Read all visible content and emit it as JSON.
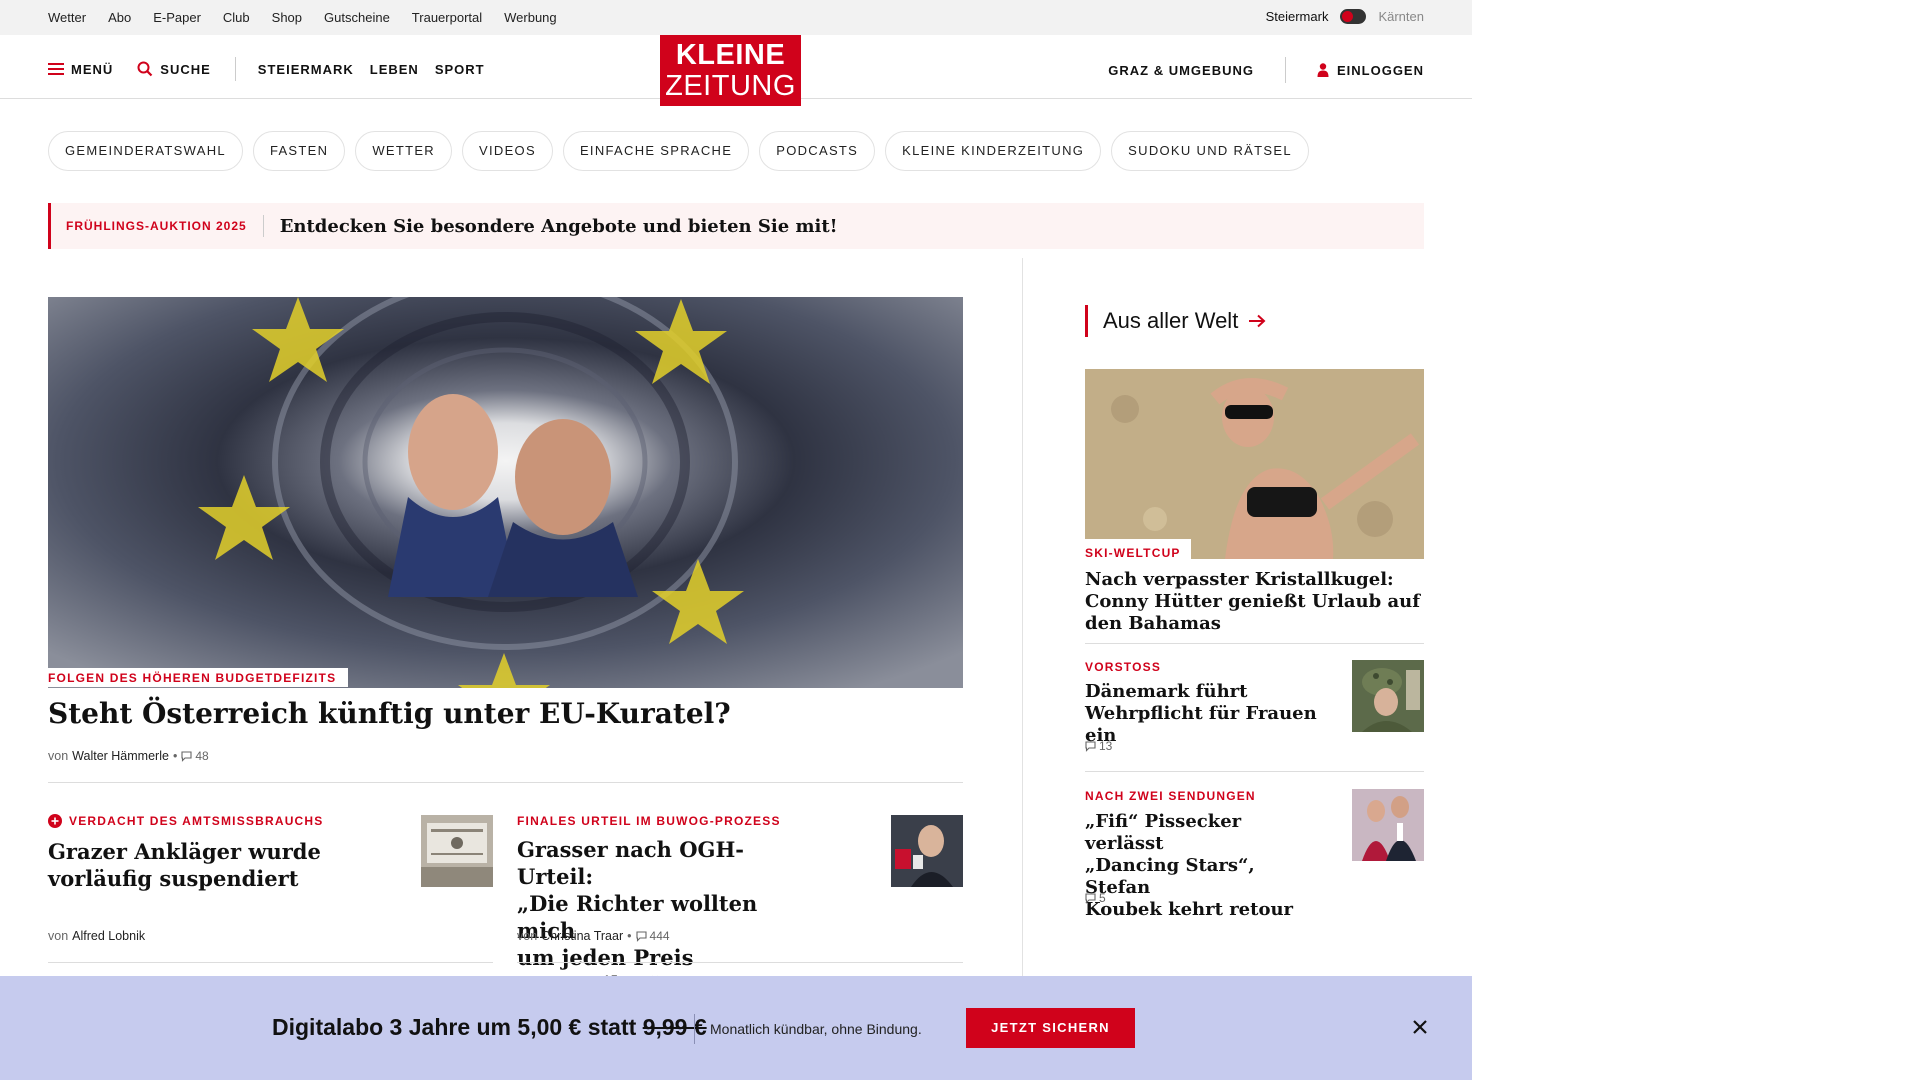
{
  "topbar": {
    "links": [
      "Wetter",
      "Abo",
      "E-Paper",
      "Club",
      "Shop",
      "Gutscheine",
      "Trauerportal",
      "Werbung"
    ],
    "region_active": "Steiermark",
    "region_inactive": "Kärnten"
  },
  "header": {
    "menu_label": "MENÜ",
    "search_label": "SUCHE",
    "nav": [
      "STEIERMARK",
      "LEBEN",
      "SPORT"
    ],
    "logo_line1": "KLEINE",
    "logo_line2": "ZEITUNG",
    "region_link": "GRAZ & UMGEBUNG",
    "login_label": "EINLOGGEN"
  },
  "tags": [
    "GEMEINDERATSWAHL",
    "FASTEN",
    "WETTER",
    "VIDEOS",
    "EINFACHE SPRACHE",
    "PODCASTS",
    "KLEINE KINDERZEITUNG",
    "SUDOKU UND RÄTSEL"
  ],
  "promo": {
    "kicker": "FRÜHLINGS-AUKTION 2025",
    "text": "Entdecken Sie besondere Angebote und bieten Sie mit!"
  },
  "lead": {
    "kicker": "FOLGEN DES HÖHEREN BUDGETDEFIZITS",
    "title": "Steht Österreich künftig unter EU-Kuratel?",
    "by": "von",
    "author": "Walter Hämmerle",
    "comments": "48"
  },
  "articles": [
    {
      "kicker": "VERDACHT DES AMTSMISSBRAUCHS",
      "title_l1": "Grazer Ankläger wurde",
      "title_l2": "vorläufig suspendiert",
      "by": "von",
      "author": "Alfred Lobnik"
    },
    {
      "kicker": "FINALES URTEIL IM BUWOG-PROZESS",
      "title_l1": "Grasser nach OGH-Urteil:",
      "title_l2": "„Die Richter wollten mich",
      "title_l3": "um jeden Preis verurteilen“",
      "by": "von",
      "author": "Christina Traar",
      "comments": "444"
    }
  ],
  "right": {
    "section_title": "Aus aller Welt",
    "feature": {
      "kicker": "SKI-WELTCUP",
      "title": "Nach verpasster Kristallkugel: Conny Hütter genießt Urlaub auf den Bahamas"
    },
    "items": [
      {
        "kicker": "VORSTOSS",
        "title_l1": "Dänemark führt",
        "title_l2": "Wehrpflicht für Frauen ein",
        "comments": "13"
      },
      {
        "kicker": "NACH ZWEI SENDUNGEN",
        "title_l1": "„Fifi“ Pissecker verlässt",
        "title_l2": "„Dancing Stars“, Stefan",
        "title_l3": "Koubek kehrt retour",
        "comments": "5"
      }
    ]
  },
  "subscription": {
    "offer_prefix": "Digitalabo 3 Jahre um 5,00 € statt ",
    "old_price": "9,99 €",
    "note": "Monatlich kündbar, ohne Bindung.",
    "cta": "JETZT SICHERN"
  },
  "colors": {
    "brand_red": "#d0021b",
    "subbar_bg": "#c6cbee",
    "promo_bg": "#fdf3f3"
  }
}
